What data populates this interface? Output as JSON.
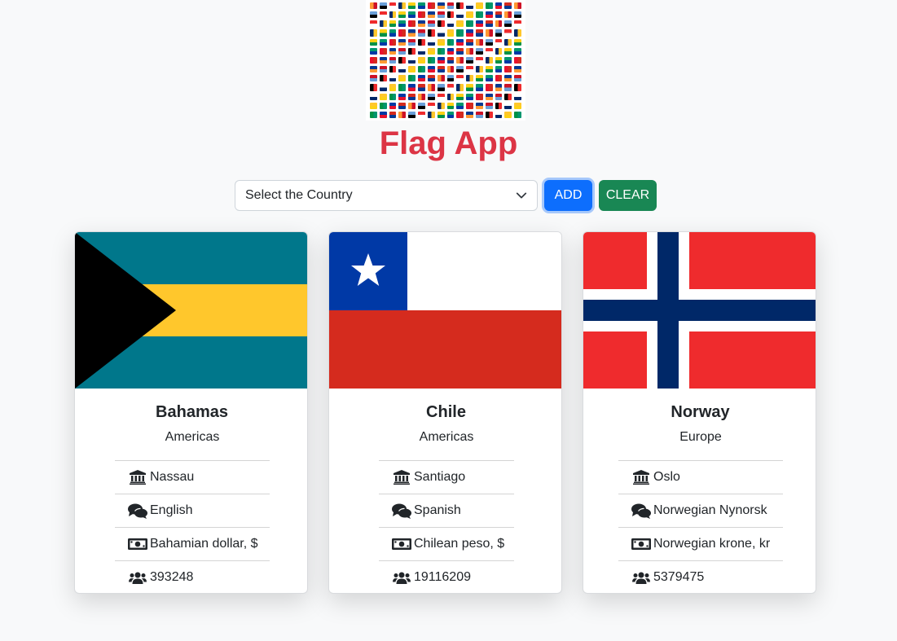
{
  "app": {
    "title": "Flag App",
    "logo_icon": "flags-collage-icon"
  },
  "controls": {
    "select_value": "Select the Country",
    "add_label": "ADD",
    "clear_label": "CLEAR"
  },
  "colors": {
    "title": "#dc3545",
    "add_button": "#0d6efd",
    "clear_button": "#198754"
  },
  "cards": [
    {
      "name": "Bahamas",
      "region": "Americas",
      "capital": "Nassau",
      "language": "English",
      "currency": "Bahamian dollar, $",
      "population": "393248"
    },
    {
      "name": "Chile",
      "region": "Americas",
      "capital": "Santiago",
      "language": "Spanish",
      "currency": "Chilean peso, $",
      "population": "19116209"
    },
    {
      "name": "Norway",
      "region": "Europe",
      "capital": "Oslo",
      "language": "Norwegian Nynorsk",
      "currency": "Norwegian krone, kr",
      "population": "5379475"
    }
  ],
  "icons": {
    "capital": "landmark-icon",
    "language": "comments-icon",
    "currency": "money-bill-icon",
    "population": "users-icon"
  }
}
